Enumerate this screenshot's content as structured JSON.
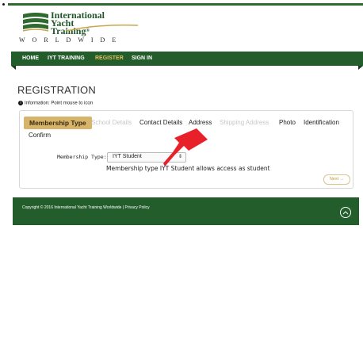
{
  "logo": {
    "line1": "International",
    "line2": "Yacht",
    "line3": "Training",
    "registered": "®",
    "tagline": "WORLDWIDE"
  },
  "nav": {
    "items": [
      {
        "label": "HOME",
        "active": false
      },
      {
        "label": "IYT TRAINING",
        "active": false
      },
      {
        "label": "REGISTER",
        "active": true
      },
      {
        "label": "SIGN IN",
        "active": false
      }
    ]
  },
  "page": {
    "title": "REGISTRATION",
    "info": "Information: Point mouse to icon"
  },
  "steps": [
    {
      "label": "Membership Type",
      "state": "active"
    },
    {
      "label": "School Details",
      "state": "disabled"
    },
    {
      "label": "Contact Details",
      "state": "enabled"
    },
    {
      "label": "Address",
      "state": "enabled"
    },
    {
      "label": "Shipping Address",
      "state": "disabled"
    },
    {
      "label": "Photo",
      "state": "enabled"
    },
    {
      "label": "Identification",
      "state": "enabled"
    },
    {
      "label": "Confirm",
      "state": "enabled"
    }
  ],
  "form": {
    "membership_label": "Membership Type:",
    "membership_value": "IYT Student",
    "membership_note": "Membership type IYT Student allows access as student",
    "next_label": "Next →"
  },
  "footer": {
    "copyright": "Copyright © 2016 International Yacht Training Worldwide | Privacy Policy"
  },
  "colors": {
    "brand_green": "#245d2c",
    "accent_gold": "#d6b469",
    "annotation_red": "#e8202a"
  }
}
